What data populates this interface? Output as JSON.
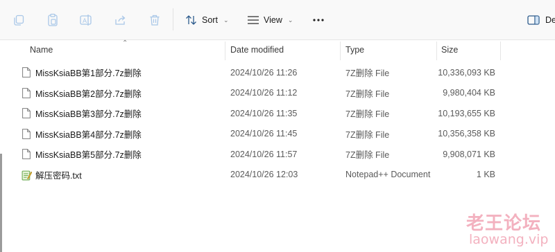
{
  "toolbar": {
    "sort_label": "Sort",
    "view_label": "View",
    "details_label": "De"
  },
  "columns": {
    "name": "Name",
    "date": "Date modified",
    "type": "Type",
    "size": "Size"
  },
  "files": [
    {
      "name": "MissKsiaBB第1部分.7z删除",
      "date": "2024/10/26 11:26",
      "type": "7Z删除 File",
      "size": "10,336,093 KB",
      "icon": "file-icon"
    },
    {
      "name": "MissKsiaBB第2部分.7z删除",
      "date": "2024/10/26 11:12",
      "type": "7Z删除 File",
      "size": "9,980,404 KB",
      "icon": "file-icon"
    },
    {
      "name": "MissKsiaBB第3部分.7z删除",
      "date": "2024/10/26 11:35",
      "type": "7Z删除 File",
      "size": "10,193,655 KB",
      "icon": "file-icon"
    },
    {
      "name": "MissKsiaBB第4部分.7z删除",
      "date": "2024/10/26 11:45",
      "type": "7Z删除 File",
      "size": "10,356,358 KB",
      "icon": "file-icon"
    },
    {
      "name": "MissKsiaBB第5部分.7z删除",
      "date": "2024/10/26 11:57",
      "type": "7Z删除 File",
      "size": "9,908,071 KB",
      "icon": "file-icon"
    },
    {
      "name": "解压密码.txt",
      "date": "2024/10/26 12:03",
      "type": "Notepad++ Document",
      "size": "1 KB",
      "icon": "notepad-plus-plus-icon"
    }
  ],
  "watermark": {
    "cn": "老王论坛",
    "en": "laowang.vip"
  }
}
